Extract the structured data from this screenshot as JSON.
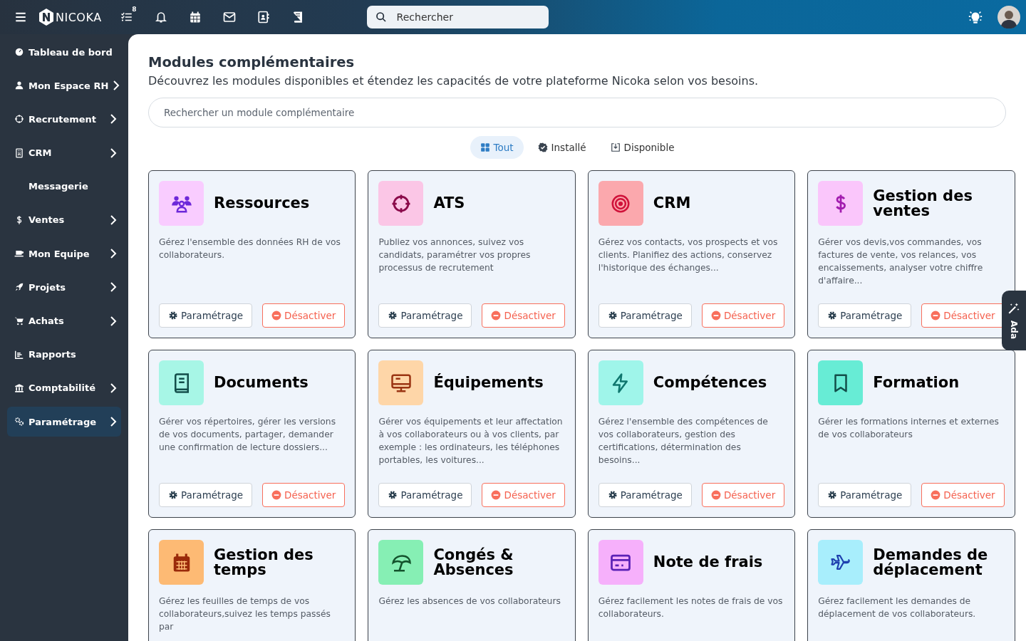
{
  "topbar": {
    "logo": "NICOKA",
    "tasks_badge": "8",
    "search": {
      "placeholder": "Rechercher"
    }
  },
  "sidebar": {
    "items": [
      {
        "label": "Tableau de bord",
        "kind": "gauge",
        "has_children": false,
        "selected": false
      },
      {
        "label": "Mon Espace RH",
        "kind": "user",
        "has_children": true,
        "selected": false
      },
      {
        "label": "Recrutement",
        "kind": "crosshair",
        "has_children": true,
        "selected": false
      },
      {
        "label": "CRM",
        "kind": "building",
        "has_children": true,
        "selected": false
      },
      {
        "label": "Messagerie",
        "has_children": false,
        "selected": false
      },
      {
        "label": "Ventes",
        "kind": "dollar",
        "has_children": true,
        "selected": false
      },
      {
        "label": "Mon Equipe",
        "kind": "laptop",
        "has_children": true,
        "selected": false
      },
      {
        "label": "Projets",
        "kind": "rocket",
        "has_children": true,
        "selected": false
      },
      {
        "label": "Achats",
        "kind": "cart",
        "has_children": true,
        "selected": false
      },
      {
        "label": "Rapports",
        "kind": "chart",
        "has_children": false,
        "selected": false
      },
      {
        "label": "Comptabilité",
        "kind": "bank",
        "has_children": true,
        "selected": false
      },
      {
        "label": "Paramétrage",
        "kind": "gears",
        "has_children": true,
        "selected": true
      }
    ]
  },
  "page": {
    "title": "Modules complémentaires",
    "subtitle": "Découvrez les modules disponibles et étendez les capacités de votre plateforme Nicoka selon vos besoins.",
    "search": {
      "placeholder": "Rechercher un module complémentaire"
    },
    "filters": [
      {
        "label": "Tout",
        "kind": "grid",
        "selected": true
      },
      {
        "label": "Installé",
        "kind": "check",
        "selected": false
      },
      {
        "label": "Disponible",
        "kind": "download",
        "selected": false
      }
    ],
    "modules": [
      {
        "title": "Ressources",
        "kind": "users",
        "color": "#f9ccff",
        "description": "Gérez l'ensemble des données RH de vos collaborateurs.",
        "buttons": [
          {
            "label": "Paramétrage",
            "kind": "settings"
          },
          {
            "label": "Désactiver",
            "kind": "deactivate"
          }
        ]
      },
      {
        "title": "ATS",
        "kind": "crosshair",
        "color": "#fbc6e6",
        "description": "Publiez vos annonces, suivez vos candidats, paramétrer vos propres processus de recrutement",
        "buttons": [
          {
            "label": "Paramétrage",
            "kind": "settings"
          },
          {
            "label": "Désactiver",
            "kind": "deactivate"
          }
        ]
      },
      {
        "title": "CRM",
        "kind": "target",
        "color": "#fba8ad",
        "description": "Gérez vos contacts, vos prospects et vos clients. Planifiez des actions, conservez l'historique des échanges...",
        "buttons": [
          {
            "label": "Paramétrage",
            "kind": "settings"
          },
          {
            "label": "Désactiver",
            "kind": "deactivate"
          }
        ]
      },
      {
        "title": "Gestion des ventes",
        "kind": "dollar",
        "color": "#fac6fb",
        "description": "Gérer vos devis,vos commandes, vos factures de vente, vos relances, vos encaissements, analyser votre chiffre d'affaire...",
        "buttons": [
          {
            "label": "Paramétrage",
            "kind": "settings"
          },
          {
            "label": "Désactiver",
            "kind": "deactivate"
          }
        ]
      },
      {
        "title": "Documents",
        "kind": "book",
        "color": "#a7f6e6",
        "description": "Gérer vos répertoires, gérer les versions de vos documents, partager, demander une confirmation de lecture dossiers...",
        "buttons": [
          {
            "label": "Paramétrage",
            "kind": "settings"
          },
          {
            "label": "Désactiver",
            "kind": "deactivate"
          }
        ]
      },
      {
        "title": "Équipements",
        "kind": "monitor",
        "color": "#fed6a8",
        "description": "Gérer vos équipements et leur affectation à vos collaborateurs ou à vos clients, par exemple : les ordinateurs, les téléphones portables, les voitures...",
        "buttons": [
          {
            "label": "Paramétrage",
            "kind": "settings"
          },
          {
            "label": "Désactiver",
            "kind": "deactivate"
          }
        ]
      },
      {
        "title": "Compétences",
        "kind": "bolt",
        "color": "#9ff5ea",
        "description": "Gérez l'ensemble des compétences de vos collaborateurs, gestion des certifications, détermination des besoins...",
        "buttons": [
          {
            "label": "Paramétrage",
            "kind": "settings"
          },
          {
            "label": "Désactiver",
            "kind": "deactivate"
          }
        ]
      },
      {
        "title": "Formation",
        "kind": "bookmark",
        "color": "#67ecd5",
        "description": "Gérer les formations internes et externes de vos collaborateurs",
        "buttons": [
          {
            "label": "Paramétrage",
            "kind": "settings"
          },
          {
            "label": "Désactiver",
            "kind": "deactivate"
          }
        ]
      },
      {
        "title": "Gestion des temps",
        "kind": "calendar",
        "color": "#fdba74",
        "description": "Gérez les feuilles de temps de vos collaborateurs,suivez les temps passés par"
      },
      {
        "title": "Congés & Absences",
        "kind": "umbrella",
        "color": "#86efb4",
        "description": "Gérez les absences de vos collaborateurs"
      },
      {
        "title": "Note de frais",
        "kind": "card",
        "color": "#f6b0fb",
        "description": "Gérez facilement les notes de frais de vos collaborateurs."
      },
      {
        "title": "Demandes de déplacement",
        "kind": "plane",
        "color": "#a8eefc",
        "description": "Gérez facilement les demandes de déplacement de vos collaborateurs."
      }
    ]
  },
  "assistant_tab": {
    "label": "Ada"
  }
}
